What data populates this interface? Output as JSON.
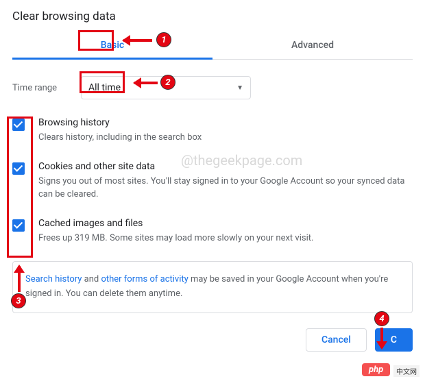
{
  "title": "Clear browsing data",
  "tabs": {
    "basic": "Basic",
    "advanced": "Advanced"
  },
  "time": {
    "label": "Time range",
    "value": "All time"
  },
  "items": [
    {
      "title": "Browsing history",
      "desc": "Clears history, including in the search box"
    },
    {
      "title": "Cookies and other site data",
      "desc": "Signs you out of most sites. You'll stay signed in to your Google Account so your synced data can be cleared."
    },
    {
      "title": "Cached images and files",
      "desc": "Frees up 319 MB. Some sites may load more slowly on your next visit."
    }
  ],
  "info": {
    "link1": "Search history",
    "and": " and ",
    "link2": "other forms of activity",
    "rest": " may be saved in your Google Account when you're signed in. You can delete them anytime."
  },
  "buttons": {
    "cancel": "Cancel",
    "clear": "C"
  },
  "annotations": {
    "n1": "1",
    "n2": "2",
    "n3": "3",
    "n4": "4"
  },
  "watermark": "@thegeekpage.com",
  "php": "php",
  "tag": "中文网"
}
